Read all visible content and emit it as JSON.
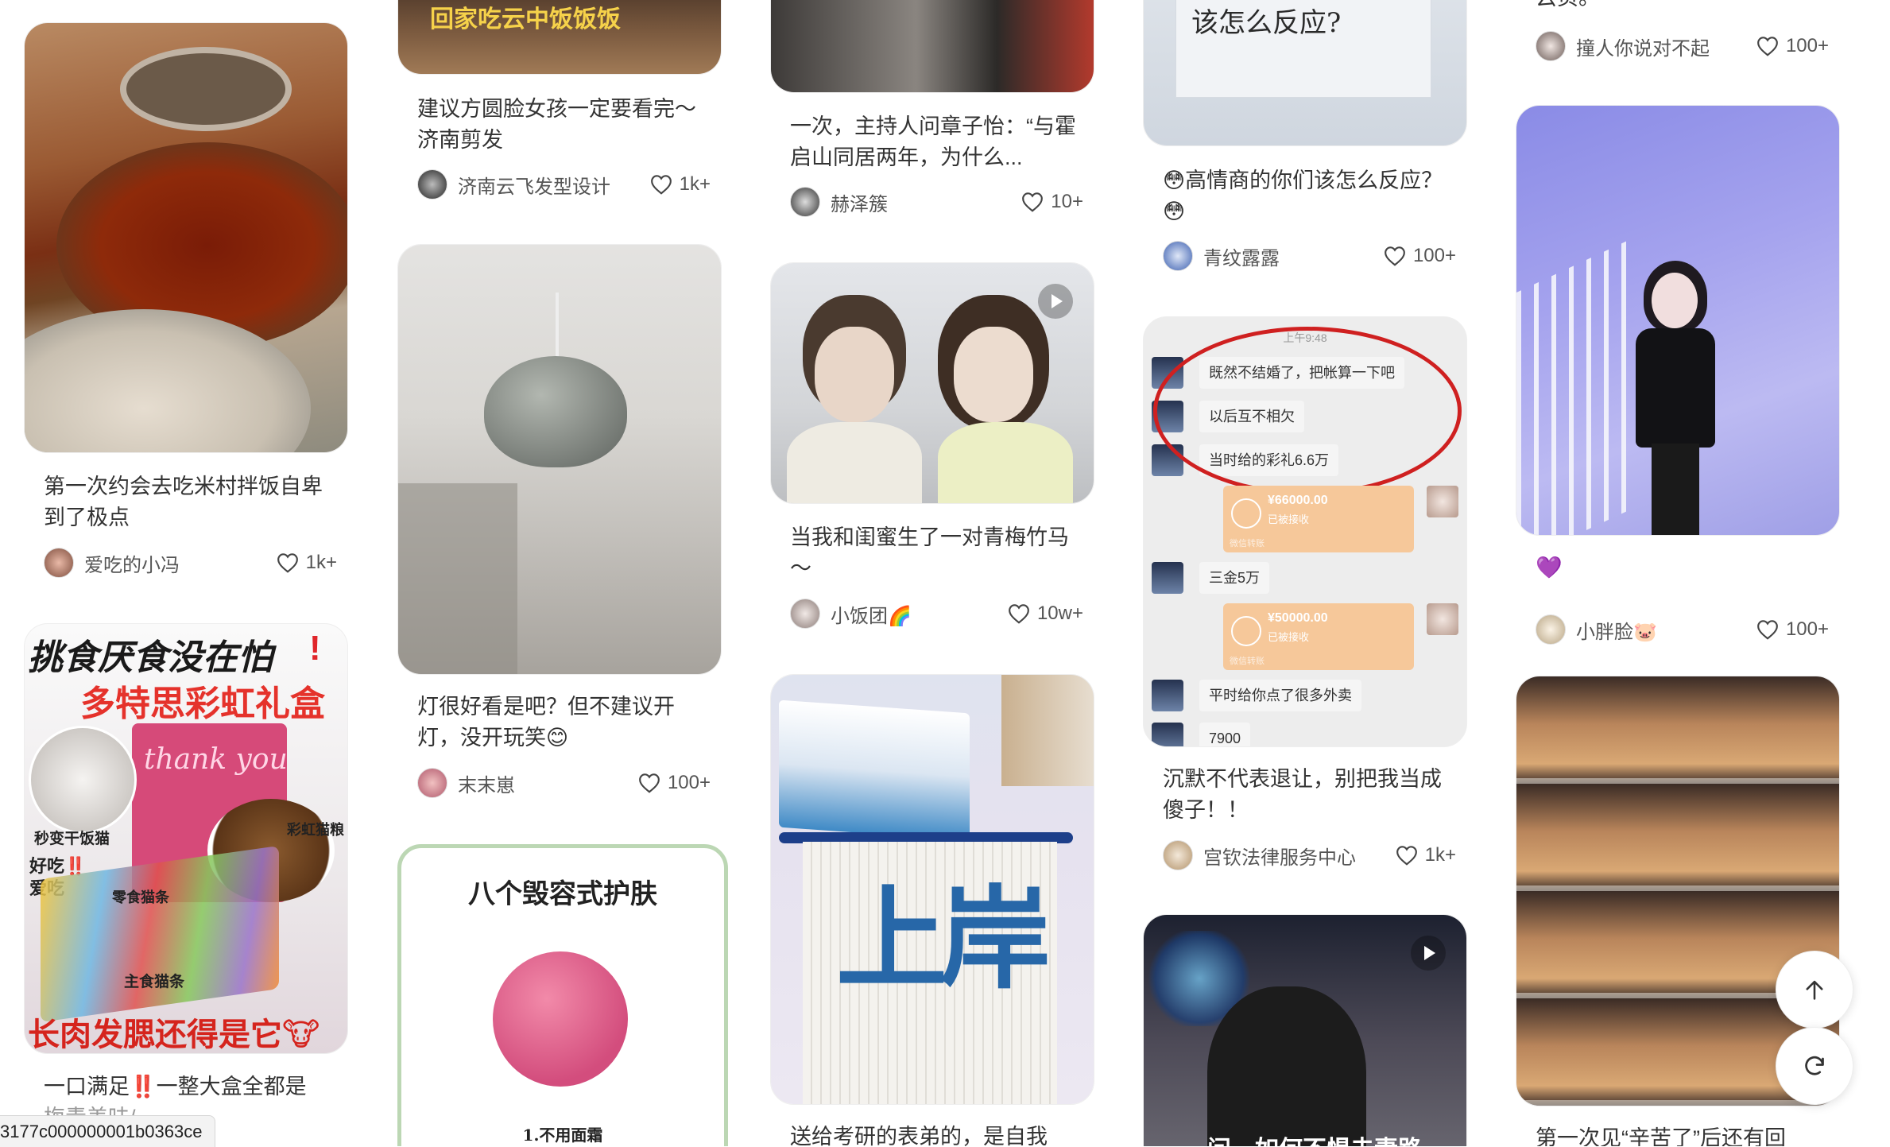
{
  "cards": {
    "c1a": {
      "title": "第一次约会去吃米村拌饭自卑到了极点",
      "author": "爱吃的小冯",
      "likes": "1k+"
    },
    "c1b": {
      "title": "一口满足‼️一整大盒全都是",
      "title_partial": "梅青美味/ ",
      "overlay": {
        "line1": "挑食厌食没在怕",
        "line2": "多特思彩虹礼盒",
        "thank": "thank you",
        "cat_label": "秒变干饭猫",
        "food_label": "彩虹猫粮",
        "tasty": "好吃‼️ 爱吃",
        "treat": "零食猫条",
        "main_treat": "主食猫条",
        "bottom": "长肉发腮还得是它🐮"
      }
    },
    "c2top": {
      "overlay": "回家吃云中饭饭饭"
    },
    "c2a": {
      "title": "建议方圆脸女孩一定要看完～济南剪发",
      "author": "济南云飞发型设计",
      "likes": "1k+"
    },
    "c2b": {
      "title": "灯很好看是吧？但不建议开灯，没开玩笑😊",
      "author": "末末崽",
      "likes": "100+"
    },
    "c2c": {
      "title_overlay": "八个毁容式护肤",
      "subtitle_overlay": "1.不用面霜"
    },
    "c3a": {
      "title": "一次，主持人问章子怡：“与霍启山同居两年，为什么...",
      "author": "赫泽簇",
      "likes": "10+"
    },
    "c3b": {
      "title": "当我和闺蜜生了一对青梅竹马～",
      "author": "小饭团🌈",
      "likes": "10w+"
    },
    "c3c": {
      "title": "送给考研的表弟的，是自我",
      "overlay": "上岸"
    },
    "c4top": {
      "overlay": "该怎么反应?"
    },
    "c4a": {
      "title": "😳高情商的你们该怎么反应？😳",
      "author": "青纹露露",
      "likes": "100+"
    },
    "c4b": {
      "title": "沉默不代表退让，别把我当成傻子！！",
      "author": "宫钦法律服务中心",
      "likes": "1k+",
      "chat": {
        "time": "上午9:48",
        "m1": "既然不结婚了，把帐算一下吧",
        "m2": "以后互不相欠",
        "m3": "当时给的彩礼6.6万",
        "t1_amount": "¥66000.00",
        "t1_status": "已被接收",
        "t1_foot": "微信转账",
        "m4": "三金5万",
        "t2_amount": "¥50000.00",
        "t2_status": "已被接收",
        "t2_foot": "微信转账",
        "m5": "平时给你点了很多外卖",
        "m6": "7900"
      }
    },
    "c4c": {
      "title_partial": "问，如何不惧夫妻路"
    },
    "c5top": {
      "title_partial": "云页。",
      "author": "撞人你说对不起",
      "likes": "100+"
    },
    "c5a": {
      "title": "💜",
      "author": "小胖脸🐷",
      "likes": "100+"
    },
    "c5b": {
      "title": "第一次见“辛苦了”后还有回"
    }
  },
  "controls": {
    "back_to_top": "back-to-top",
    "refresh": "refresh"
  },
  "status_url": "3177c000000001b0363ce"
}
